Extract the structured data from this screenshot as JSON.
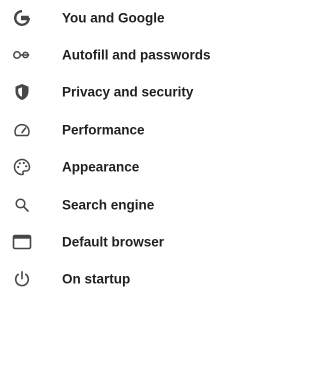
{
  "sidebar": {
    "icon_color": "#474747",
    "text_color": "#1f1f1f",
    "items": [
      {
        "label": "You and Google",
        "icon": "google-g-icon"
      },
      {
        "label": "Autofill and passwords",
        "icon": "key-icon"
      },
      {
        "label": "Privacy and security",
        "icon": "shield-icon"
      },
      {
        "label": "Performance",
        "icon": "speedometer-icon"
      },
      {
        "label": "Appearance",
        "icon": "palette-icon"
      },
      {
        "label": "Search engine",
        "icon": "search-icon"
      },
      {
        "label": "Default browser",
        "icon": "browser-window-icon"
      },
      {
        "label": "On startup",
        "icon": "power-icon"
      }
    ]
  }
}
